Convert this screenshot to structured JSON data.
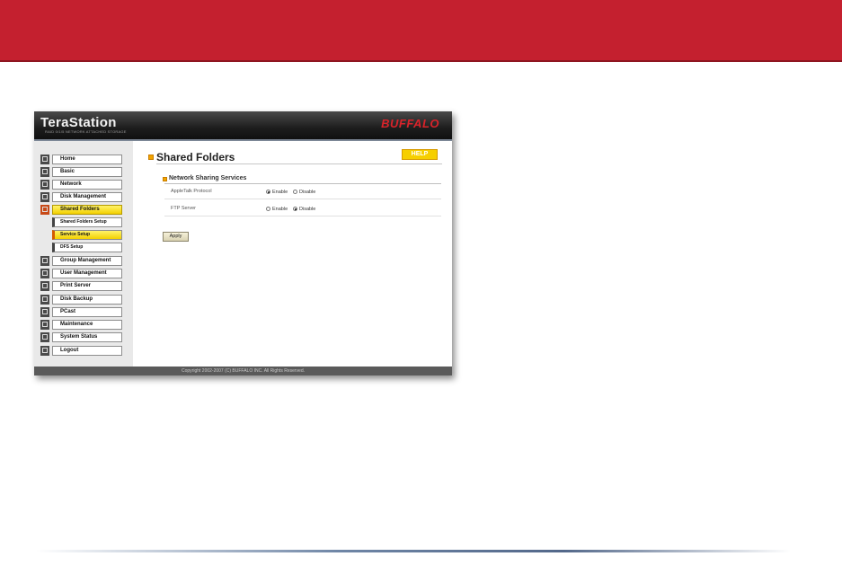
{
  "app": {
    "logo": "TeraStation",
    "tagline": "RAID 0/1/5 NETWORK ATTACHED STORAGE",
    "brand": "BUFFALO"
  },
  "sidebar": {
    "items": [
      {
        "label": "Home",
        "icon": "home-icon"
      },
      {
        "label": "Basic",
        "icon": "basic-settings-icon"
      },
      {
        "label": "Network",
        "icon": "network-icon"
      },
      {
        "label": "Disk Management",
        "icon": "disk-icon"
      },
      {
        "label": "Shared Folders",
        "icon": "folder-icon",
        "active": true
      },
      {
        "label": "Group Management",
        "icon": "group-icon"
      },
      {
        "label": "User Management",
        "icon": "user-icon"
      },
      {
        "label": "Print Server",
        "icon": "printer-icon"
      },
      {
        "label": "Disk Backup",
        "icon": "backup-icon"
      },
      {
        "label": "PCast",
        "icon": "pcast-icon"
      },
      {
        "label": "Maintenance",
        "icon": "maintenance-icon"
      },
      {
        "label": "System Status",
        "icon": "status-icon"
      },
      {
        "label": "Logout",
        "icon": "logout-icon"
      }
    ],
    "subitems": [
      {
        "label": "Shared Folders Setup"
      },
      {
        "label": "Service Setup",
        "active": true
      },
      {
        "label": "DFS Setup"
      }
    ]
  },
  "main": {
    "title": "Shared Folders",
    "help_label": "HELP",
    "section_title": "Network Sharing Services",
    "rows": [
      {
        "label": "AppleTalk Protocol",
        "enable_label": "Enable",
        "disable_label": "Disable",
        "selected": "Enable"
      },
      {
        "label": "FTP Server",
        "enable_label": "Enable",
        "disable_label": "Disable",
        "selected": "Disable"
      }
    ],
    "apply_label": "Apply"
  },
  "footer": {
    "copyright": "Copyright 2002-2007 (C) BUFFALO INC. All Rights Reserved."
  },
  "colors": {
    "banner": "#c4202f",
    "active_nav": "#f3d000",
    "help_button": "#f6cf00"
  }
}
